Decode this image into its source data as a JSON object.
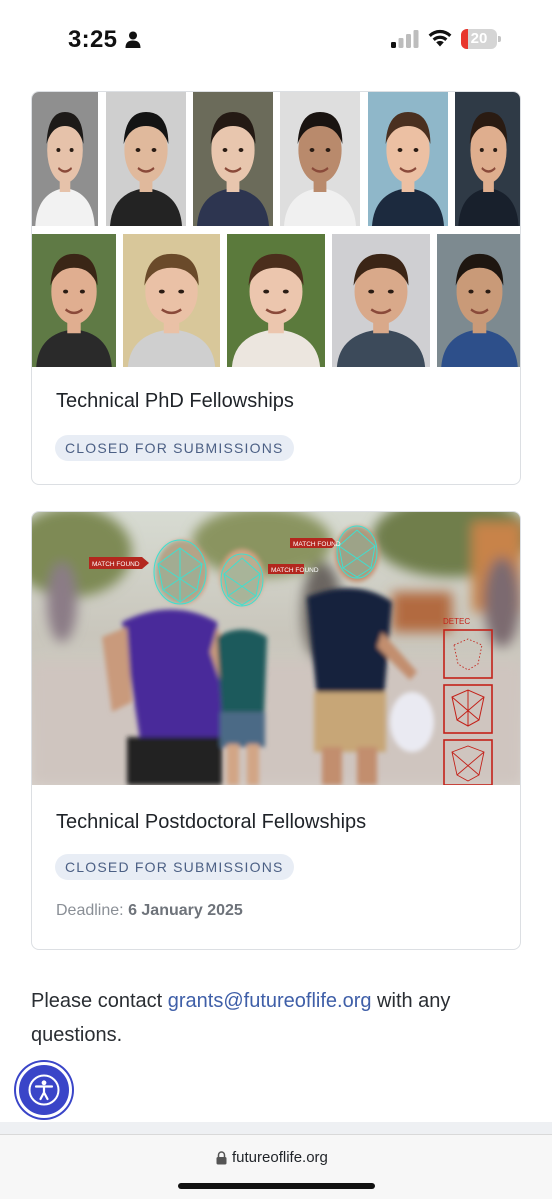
{
  "status_bar": {
    "time": "3:25",
    "battery_level": "20",
    "battery_fraction": 0.2,
    "battery_color": "#e8362d"
  },
  "cards": [
    {
      "title": "Technical PhD Fellowships",
      "status": "CLOSED FOR SUBMISSIONS",
      "image": "fellow-portraits-grid"
    },
    {
      "title": "Technical Postdoctoral Fellowships",
      "status": "CLOSED FOR SUBMISSIONS",
      "deadline_label": "Deadline:",
      "deadline_value": "6 January 2025",
      "image": "face-recognition-street-scene",
      "image_labels": [
        "MATCH FOUND",
        "MATCH FOUND",
        "MATCH FOUND",
        "DETEC"
      ]
    }
  ],
  "contact": {
    "prefix": "Please contact ",
    "email": "grants@futureoflife.org",
    "suffix": " with any questions."
  },
  "browser": {
    "url": "futureoflife.org"
  },
  "colors": {
    "badge_bg": "#e8edf5",
    "badge_text": "#4c6085",
    "link": "#3f5fa8",
    "accessibility_button": "#3a45c8"
  },
  "icons": [
    "person-icon",
    "cellular-signal-icon",
    "wifi-icon",
    "battery-icon",
    "accessibility-icon",
    "lock-icon"
  ]
}
